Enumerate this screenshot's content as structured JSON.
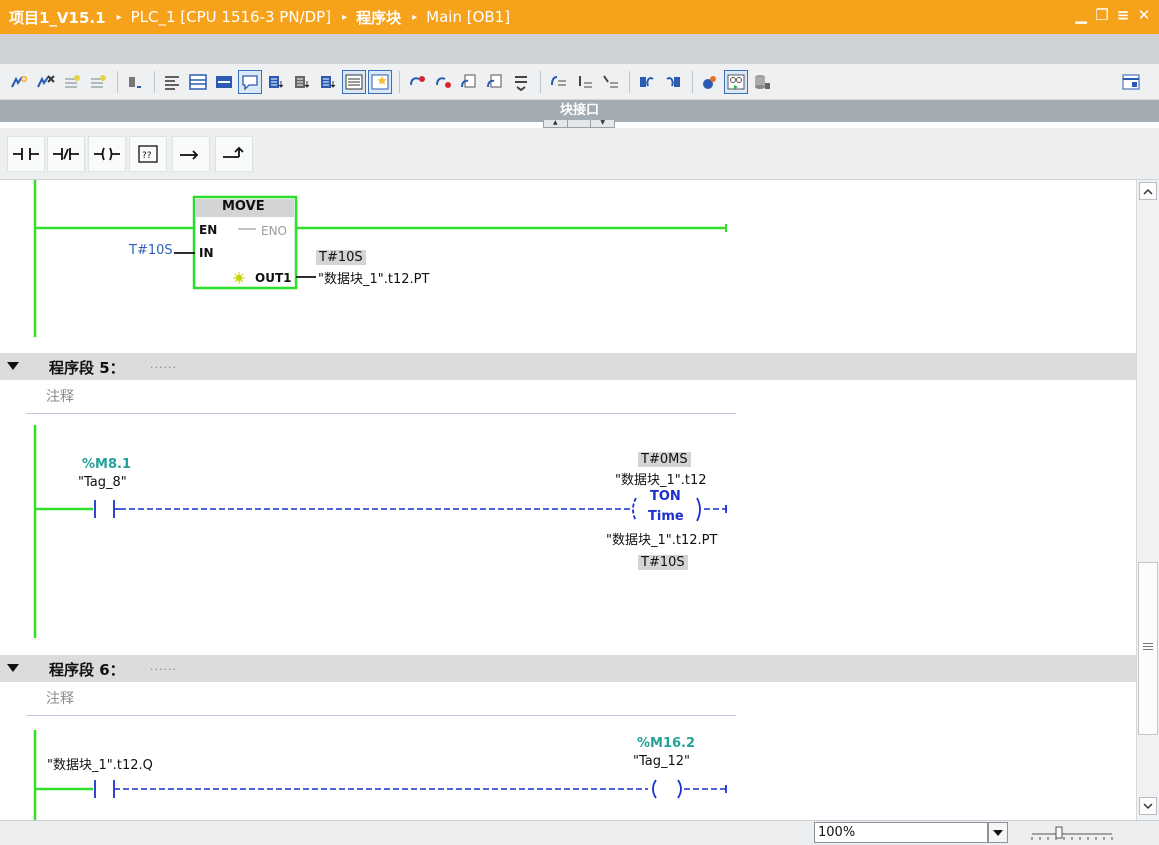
{
  "titlebar": {
    "crumbs": [
      "项目1_V15.1",
      "PLC_1 [CPU 1516-3 PN/DP]",
      "程序块",
      "Main [OB1]"
    ],
    "separator": "▸",
    "minimize": "▁",
    "restore": "❐",
    "menu": "≡",
    "close": "✕"
  },
  "toolbar": {
    "icons": [
      "insert-network-icon",
      "delete-network-icon",
      "insert-row-icon",
      "add-row-icon",
      "lock-icon",
      "absolute-operands-icon",
      "network-comments-icon",
      "favorites-icon",
      "comment-icon",
      "step-display-icon",
      "step-display-2-icon",
      "step-display-3-icon",
      "all-networks-icon",
      "favorites-star-icon",
      "connect-icon",
      "delete-connect-icon",
      "go-to-error-icon",
      "go-to-error-next-icon",
      "monitor-icon",
      "first-network-icon",
      "next-network-icon",
      "prev-network-icon",
      "update-left-icon",
      "update-right-icon",
      "tags-icon",
      "monitoring-icon",
      "database-icon"
    ]
  },
  "interface_bar": {
    "label": "块接口"
  },
  "favorites": {
    "items": [
      "no-contact",
      "nc-contact",
      "coil",
      "empty-box",
      "open-branch",
      "close-branch"
    ]
  },
  "network4": {
    "block": {
      "name": "MOVE",
      "en": "EN",
      "eno": "ENO",
      "in": "IN",
      "out1": "OUT1"
    },
    "in_value": "T#10S",
    "out_value_box": "T#10S",
    "out_tag": "\"数据块_1\".t12.PT"
  },
  "network5": {
    "title": "程序段 5：",
    "dots": "......",
    "comment": "注释",
    "contact_address": "%M8.1",
    "contact_tag": "\"Tag_8\"",
    "timer_value_top": "T#0MS",
    "timer_db": "\"数据块_1\".t12",
    "timer_type": "TON",
    "timer_sub": "Time",
    "timer_pt": "\"数据块_1\".t12.PT",
    "timer_value_bottom": "T#10S"
  },
  "network6": {
    "title": "程序段 6：",
    "dots": "......",
    "comment": "注释",
    "contact_tag": "\"数据块_1\".t12.Q",
    "coil_address": "%M16.2",
    "coil_tag": "\"Tag_12\""
  },
  "statusbar": {
    "zoom": "100%"
  },
  "colors": {
    "title_orange": "#f7a21b",
    "power_rail_green": "#32e02a",
    "rung_blue": "#1c2fd1",
    "box_green": "#2adf2a",
    "tag_teal": "#24a19b"
  }
}
